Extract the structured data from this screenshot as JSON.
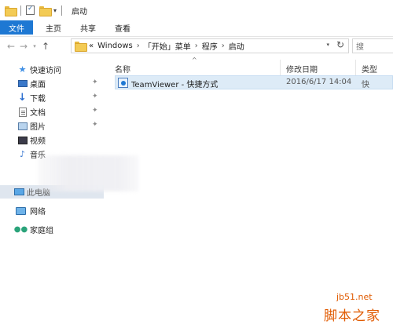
{
  "window": {
    "title": "启动"
  },
  "ribbon": {
    "tabs": [
      "文件",
      "主页",
      "共享",
      "查看"
    ]
  },
  "address": {
    "prefix": "«",
    "crumbs": [
      "Windows",
      "「开始」菜单",
      "程序",
      "启动"
    ],
    "separator": "›",
    "search_placeholder": "搜"
  },
  "nav": {
    "quick_access": "快速访问",
    "items": [
      {
        "label": "桌面",
        "pinned": true,
        "icon": "desktop-icon"
      },
      {
        "label": "下载",
        "pinned": true,
        "icon": "download-icon"
      },
      {
        "label": "文档",
        "pinned": true,
        "icon": "document-icon"
      },
      {
        "label": "图片",
        "pinned": true,
        "icon": "pictures-icon"
      },
      {
        "label": "视频",
        "pinned": false,
        "icon": "video-icon"
      },
      {
        "label": "音乐",
        "pinned": false,
        "icon": "music-icon"
      }
    ],
    "this_pc": "此电脑",
    "network": "网络",
    "homegroup": "家庭组"
  },
  "columns": {
    "name": "名称",
    "date": "修改日期",
    "type": "类型"
  },
  "files": [
    {
      "name": "TeamViewer - 快捷方式",
      "date": "2016/6/17 14:04",
      "type": "快"
    }
  ],
  "watermark": {
    "domain": "jb51.net",
    "name": "脚本之家"
  }
}
